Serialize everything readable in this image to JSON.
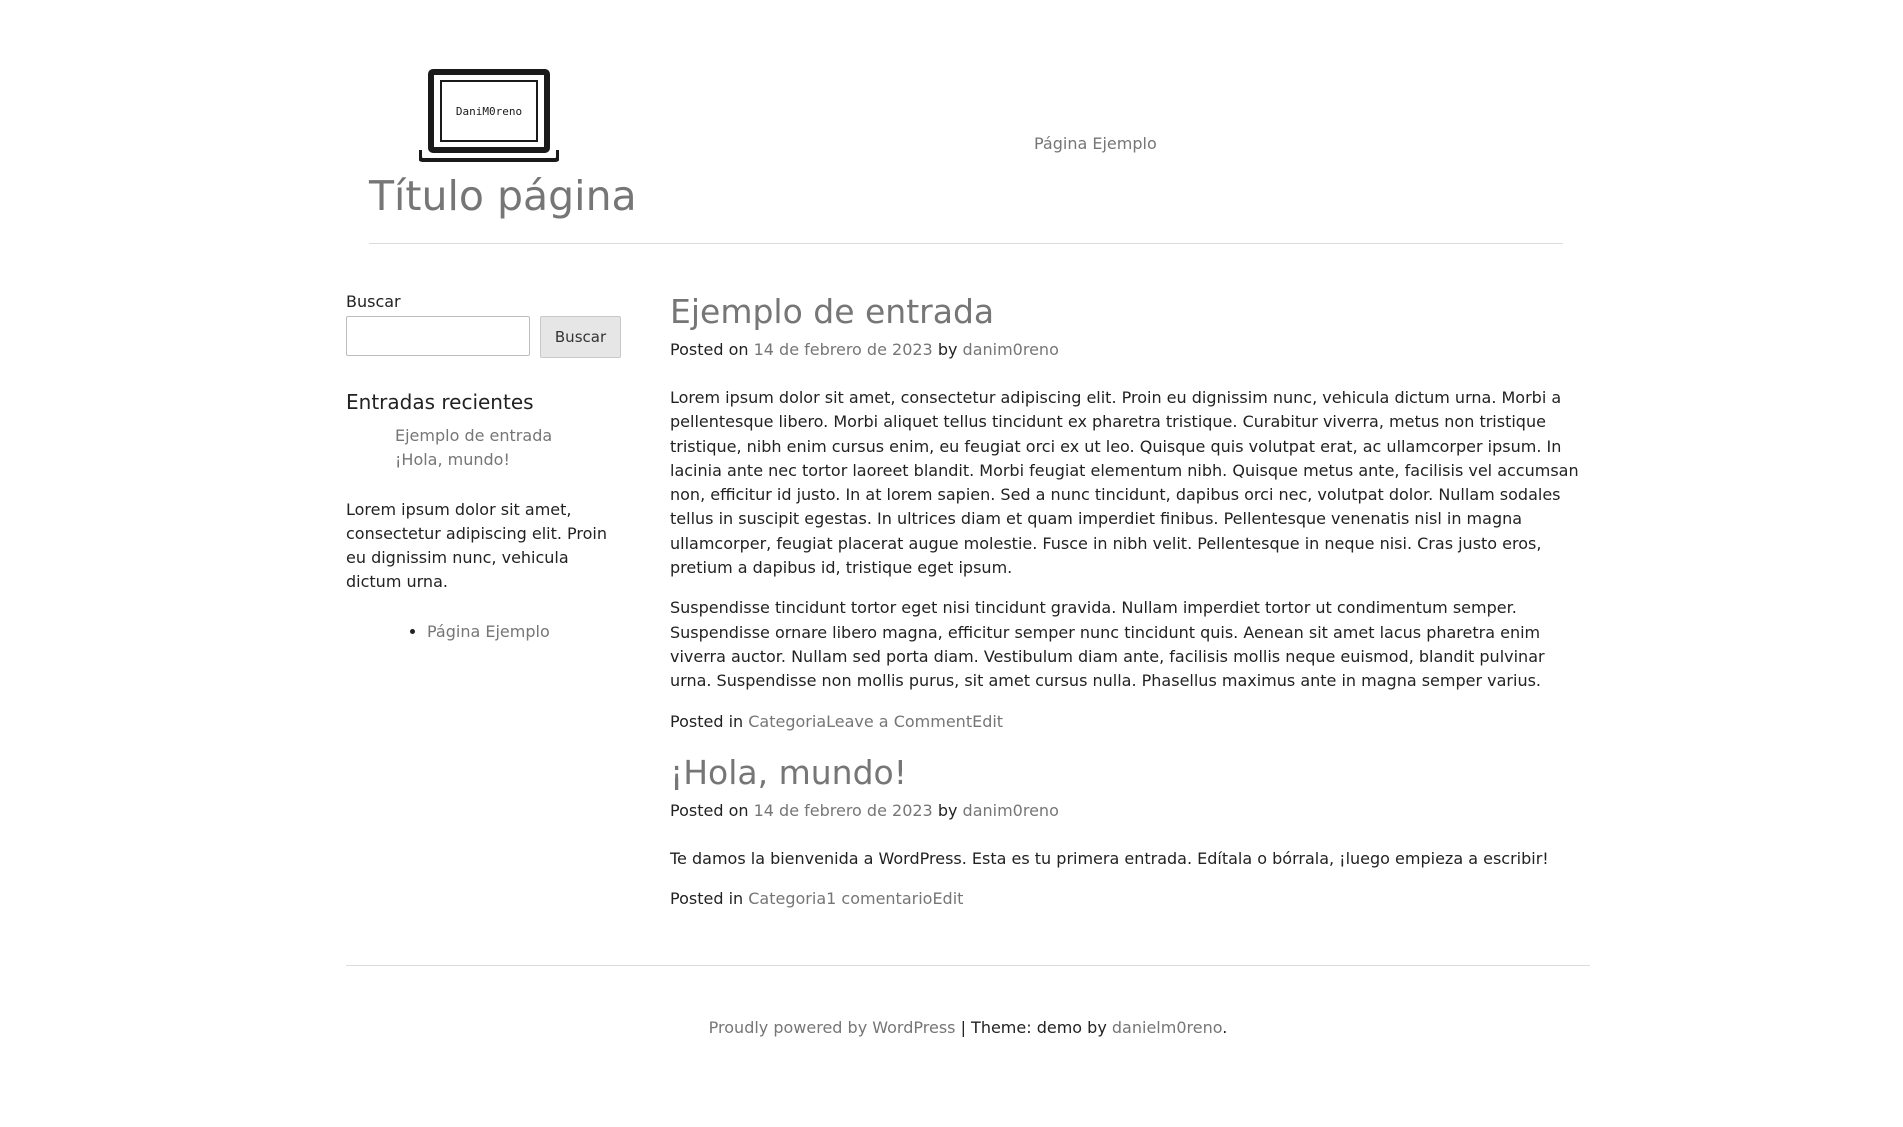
{
  "header": {
    "logo_text": "DaniM0reno",
    "site_title": "Título página",
    "nav_item": "Página Ejemplo"
  },
  "sidebar": {
    "search_label": "Buscar",
    "search_placeholder": "",
    "search_value": "",
    "search_button": "Buscar",
    "recent_title": "Entradas recientes",
    "recent_posts": [
      "Ejemplo de entrada",
      "¡Hola, mundo!"
    ],
    "text_widget": "Lorem ipsum dolor sit amet, consectetur adipiscing elit. Proin eu dignissim nunc, vehicula dictum urna.",
    "pages": [
      "Página Ejemplo"
    ]
  },
  "posts": [
    {
      "title": "Ejemplo de entrada",
      "posted_on_label": "Posted on",
      "date": "14 de febrero de 2023",
      "by_label": "by",
      "author": "danim0reno",
      "paragraphs": [
        "Lorem ipsum dolor sit amet, consectetur adipiscing elit. Proin eu dignissim nunc, vehicula dictum urna. Morbi a pellentesque libero. Morbi aliquet tellus tincidunt ex pharetra tristique. Curabitur viverra, metus non tristique tristique, nibh enim cursus enim, eu feugiat orci ex ut leo. Quisque quis volutpat erat, ac ullamcorper ipsum. In lacinia ante nec tortor laoreet blandit. Morbi feugiat elementum nibh. Quisque metus ante, facilisis vel accumsan non, efficitur id justo. In at lorem sapien. Sed a nunc tincidunt, dapibus orci nec, volutpat dolor. Nullam sodales tellus in suscipit egestas. In ultrices diam et quam imperdiet finibus. Pellentesque venenatis nisl in magna ullamcorper, feugiat placerat augue molestie. Fusce in nibh velit. Pellentesque in neque nisi. Cras justo eros, pretium a dapibus id, tristique eget ipsum.",
        "Suspendisse tincidunt tortor eget nisi tincidunt gravida. Nullam imperdiet tortor ut condimentum semper. Suspendisse ornare libero magna, efficitur semper nunc tincidunt quis. Aenean sit amet lacus pharetra enim viverra auctor. Nullam sed porta diam. Vestibulum diam ante, facilisis mollis neque euismod, blandit pulvinar urna. Suspendisse non mollis purus, sit amet cursus nulla. Phasellus maximus ante in magna semper varius."
      ],
      "posted_in_label": "Posted in",
      "category": "Categoria",
      "comments": "Leave a Comment",
      "edit": "Edit"
    },
    {
      "title": "¡Hola, mundo!",
      "posted_on_label": "Posted on",
      "date": "14 de febrero de 2023",
      "by_label": "by",
      "author": "danim0reno",
      "paragraphs": [
        "Te damos la bienvenida a WordPress. Esta es tu primera entrada. Edítala o bórrala, ¡luego empieza a escribir!"
      ],
      "posted_in_label": "Posted in",
      "category": "Categoria",
      "comments": "1 comentario",
      "edit": "Edit"
    }
  ],
  "footer": {
    "powered_link": "Proudly powered by WordPress",
    "separator": " | ",
    "theme_label": "Theme: demo by ",
    "theme_author": "danielm0reno",
    "period": "."
  },
  "colors": {
    "link": "#767676",
    "text": "#222222",
    "border": "#dcdcdc",
    "button_bg": "#e6e6e6"
  }
}
